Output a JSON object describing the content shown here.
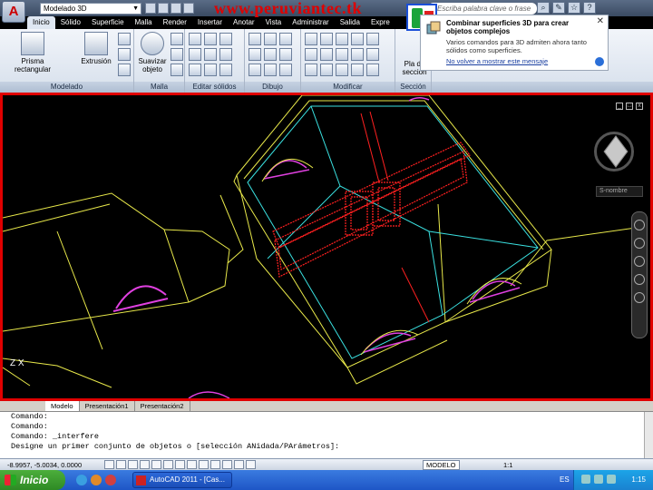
{
  "title_bar": {
    "app_button": "A",
    "workspace": "Modelado 3D",
    "watermark": "www.peruviantec.tk",
    "search_placeholder": "Escriba palabra clave o frase"
  },
  "ribbon_tabs": [
    "Inicio",
    "Sólido",
    "Superficie",
    "Malla",
    "Render",
    "Insertar",
    "Anotar",
    "Vista",
    "Administrar",
    "Salida",
    "Expre"
  ],
  "ribbon": {
    "modelado": {
      "label": "Modelado",
      "prisma": "Prisma rectangular",
      "extrusion": "Extrusión"
    },
    "malla": {
      "label": "Malla",
      "suavizar": "Suavizar objeto"
    },
    "editar_solidos": {
      "label": "Editar sólidos"
    },
    "dibujo": {
      "label": "Dibujo"
    },
    "modificar": {
      "label": "Modificar"
    },
    "seccion": {
      "label": "Sección",
      "plano": "Pla de sección"
    }
  },
  "tooltip": {
    "title": "Combinar superficies 3D para crear objetos complejos",
    "body": "Varios comandos para 3D admiten ahora tanto sólidos como superficies.",
    "link": "No volver a mostrar este mensaje",
    "close": "✕"
  },
  "viewport": {
    "wcs_label": "S-nombre",
    "ucs_label": "Z   X"
  },
  "layout_tabs": [
    "Modelo",
    "Presentación1",
    "Presentación2"
  ],
  "command_lines": [
    "Comando:",
    "Comando:",
    "Comando: _interfere",
    "Designe un primer conjunto de objetos o [selección ANidada/PArámetros]:"
  ],
  "status_bar": {
    "coords": "-8.9957, -5.0034, 0.0000",
    "space": "MODELO",
    "scale": "1:1"
  },
  "taskbar": {
    "start": "Inicio",
    "task": "AutoCAD 2011 - [Cas...",
    "lang": "ES",
    "clock": "1:15"
  },
  "colors": {
    "viewport_border": "#e00000",
    "wire_yellow": "#e8e84a",
    "wire_cyan": "#3ae0e0",
    "wire_red": "#ff2020",
    "wire_magenta": "#e040e0"
  }
}
